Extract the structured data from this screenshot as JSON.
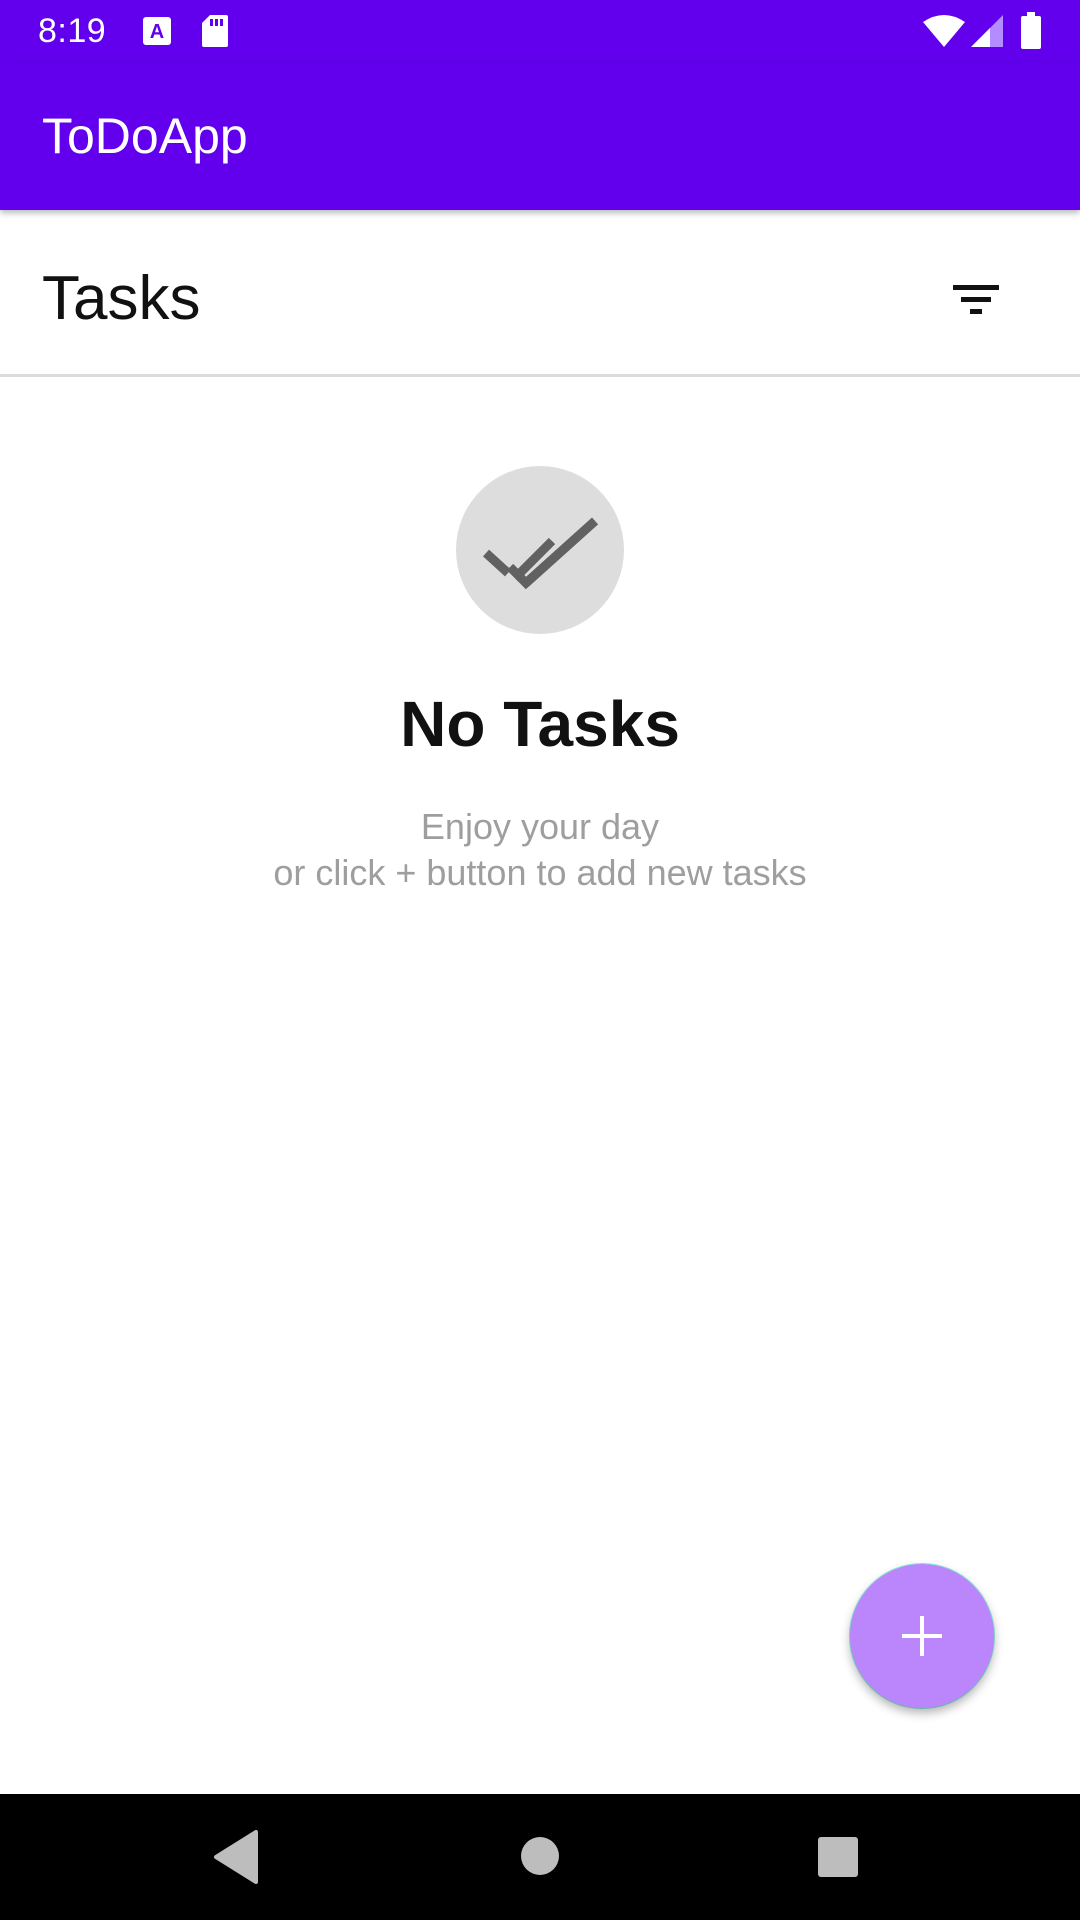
{
  "status_bar": {
    "time": "8:19",
    "icons": [
      "keyboard-a-icon",
      "sd-card-icon",
      "wifi-icon",
      "signal-icon",
      "battery-icon"
    ]
  },
  "app_bar": {
    "title": "ToDoApp"
  },
  "section": {
    "title": "Tasks",
    "filter_icon": "filter-list-icon"
  },
  "empty_state": {
    "icon": "done-all-icon",
    "title": "No Tasks",
    "message_line1": "Enjoy your day",
    "message_line2": "or click + button to add new tasks"
  },
  "fab": {
    "icon": "add-icon"
  },
  "nav_bar": {
    "buttons": [
      "back-icon",
      "home-icon",
      "recents-icon"
    ]
  },
  "colors": {
    "primary": "#6200ee",
    "fab": "#bb86fc",
    "empty_circle": "#dddddd",
    "secondary_text": "#9e9e9e"
  }
}
